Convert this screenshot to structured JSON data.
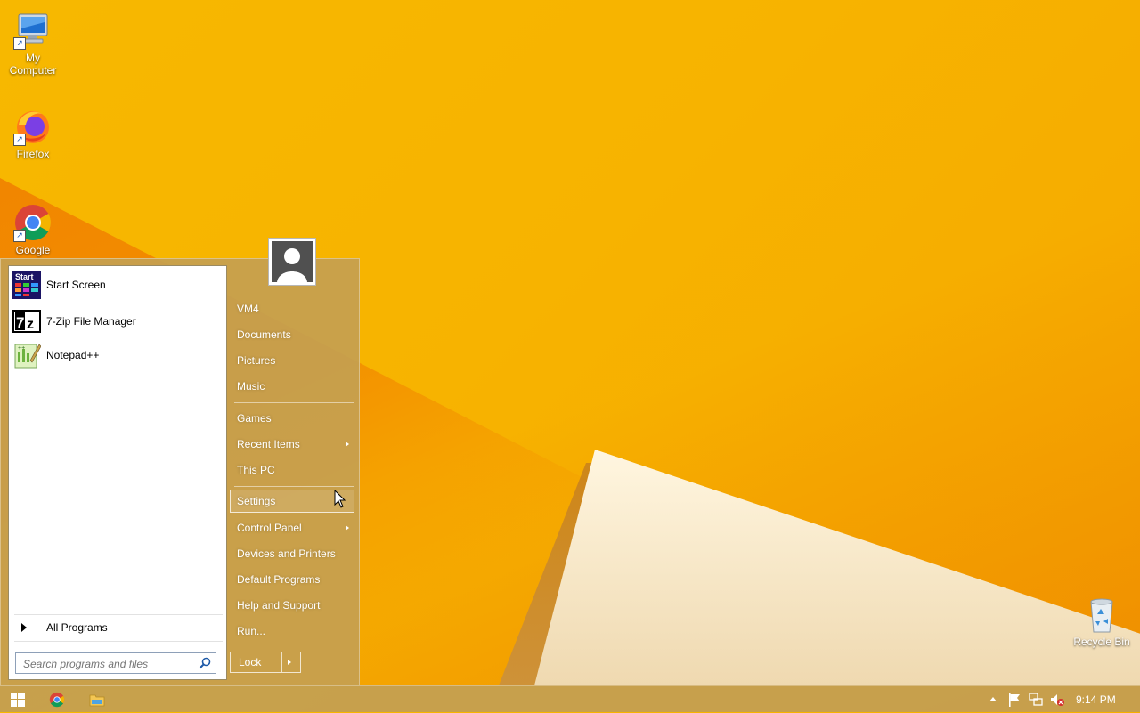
{
  "desktop": {
    "icons": [
      {
        "label": "My\nComputer",
        "icon": "my-computer-icon"
      },
      {
        "label": "Firefox",
        "icon": "firefox-icon"
      },
      {
        "label": "Google",
        "icon": "chrome-icon"
      },
      {
        "label": "Recycle Bin",
        "icon": "recycle-bin-icon"
      }
    ]
  },
  "start_menu": {
    "pinned": [
      {
        "label": "Start Screen",
        "icon": "start-screen-icon"
      },
      {
        "label": "7-Zip File Manager",
        "icon": "7zip-icon"
      },
      {
        "label": "Notepad++",
        "icon": "notepad-plus-plus-icon"
      }
    ],
    "all_programs": "All Programs",
    "search_placeholder": "Search programs and files",
    "right_items": [
      {
        "label": "VM4"
      },
      {
        "label": "Documents"
      },
      {
        "label": "Pictures"
      },
      {
        "label": "Music"
      },
      {
        "label": "Games"
      },
      {
        "label": "Recent Items",
        "submenu": true
      },
      {
        "label": "This PC"
      },
      {
        "label": "Settings",
        "highlighted": true
      },
      {
        "label": "Control Panel",
        "submenu": true
      },
      {
        "label": "Devices and Printers"
      },
      {
        "label": "Default Programs"
      },
      {
        "label": "Help and Support"
      },
      {
        "label": "Run..."
      }
    ],
    "lock_label": "Lock"
  },
  "taskbar": {
    "clock": "9:14 PM",
    "pinned": [
      "windows-start-icon",
      "chrome-icon",
      "file-explorer-icon"
    ],
    "tray": [
      "show-hidden-icons-chevron",
      "action-center-flag-icon",
      "network-icon",
      "volume-muted-icon"
    ]
  },
  "colors": {
    "wallpaper": "#f7b800",
    "menu_glass": "#c4a050",
    "chrome_red": "#db4437",
    "chrome_yellow": "#f4b400",
    "chrome_green": "#0f9d58",
    "chrome_blue": "#4285f4"
  }
}
